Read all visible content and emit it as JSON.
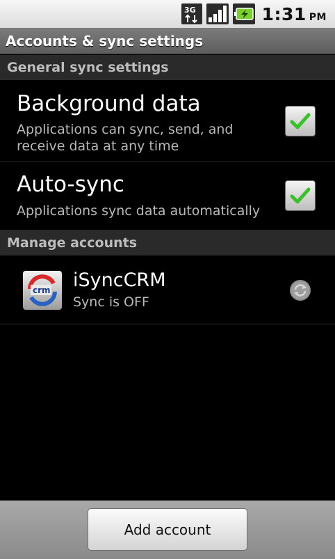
{
  "status_bar": {
    "network_icon": "3g-icon",
    "signal_icon": "signal-icon",
    "battery_icon": "battery-charging-icon",
    "time": "1:31",
    "ampm": "PM"
  },
  "title_bar": {
    "title": "Accounts & sync settings"
  },
  "general": {
    "header": "General sync settings",
    "items": [
      {
        "title": "Background data",
        "summary": "Applications can sync, send, and receive data at any time",
        "checked": true
      },
      {
        "title": "Auto-sync",
        "summary": "Applications sync data automatically",
        "checked": true
      }
    ]
  },
  "manage": {
    "header": "Manage accounts",
    "accounts": [
      {
        "name": "iSyncCRM",
        "status": "Sync is OFF",
        "icon_text": "crm",
        "icon": "crm-sync-icon"
      }
    ]
  },
  "bottom": {
    "add_account_label": "Add account"
  },
  "colors": {
    "check": "#39c02a",
    "section_bg": "#2a2a2a",
    "accent_red": "#d62b2b",
    "accent_blue": "#2a62c4"
  }
}
